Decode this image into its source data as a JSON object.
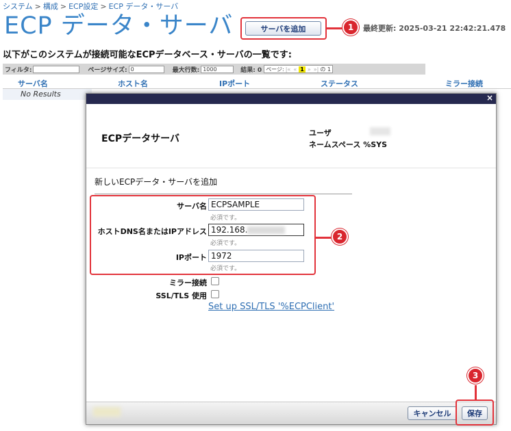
{
  "breadcrumb": {
    "items": [
      "システム",
      "構成",
      "ECP設定",
      "ECP データ・サーバ"
    ],
    "separator": ">"
  },
  "page": {
    "title": "ECP データ・サーバ",
    "add_button": "サーバを追加",
    "last_updated": "最終更新: 2025-03-21 22:42:21.478",
    "list_heading": "以下がこのシステムが接続可能なECPデータベース・サーバの一覧です:"
  },
  "filter_bar": {
    "filter_label": "フィルタ:",
    "filter_value": "",
    "page_size_label": "ページサイズ:",
    "page_size_value": "0",
    "max_rows_label": "最大行数:",
    "max_rows_value": "1000",
    "results_label": "結果: 0",
    "page_label": "ページ:",
    "first": "|«",
    "prev": "«",
    "current_page": "1",
    "next": "»",
    "last": "»|",
    "of_pages": "の 1"
  },
  "table": {
    "columns": [
      "サーバ名",
      "ホスト名",
      "IPポート",
      "ステータス",
      "ミラー接続"
    ],
    "empty_text": "No Results"
  },
  "dialog": {
    "heading": "ECPデータサーバ",
    "user_label": "ユーザ",
    "namespace_label": "ネームスペース",
    "namespace_value": "%SYS",
    "close": "×",
    "form_title": "新しいECPデータ・サーバを追加",
    "fields": {
      "server_name_label": "サーバ名",
      "server_name_value": "ECPSAMPLE",
      "host_label": "ホストDNS名またはIPアドレス",
      "host_value": "192.168.",
      "port_label": "IPポート",
      "port_value": "1972",
      "required_text": "必須です。",
      "mirror_label": "ミラー接続",
      "ssl_label": "SSL/TLS 使用"
    },
    "ssl_link": "Set up SSL/TLS '%ECPClient'",
    "cancel_button": "キャンセル",
    "save_button": "保存"
  },
  "annotations": {
    "step1": "1",
    "step2": "2",
    "step3": "3",
    "color": "#e2323a"
  },
  "colors": {
    "title_blue": "#3a85c9",
    "link_blue": "#2f6fb3",
    "dialog_titlebar": "#26294f",
    "highlight_red": "#e2323a"
  }
}
